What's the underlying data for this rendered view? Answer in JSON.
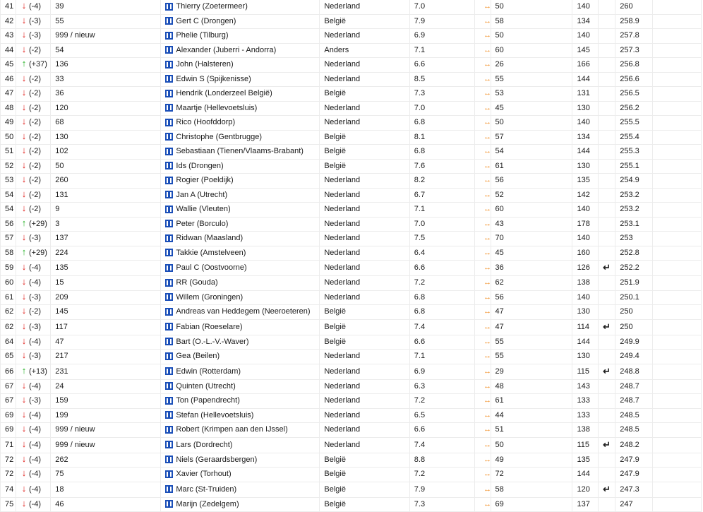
{
  "colors": {
    "down": "#e0201c",
    "up": "#22b022",
    "swap": "#f08a1c",
    "player_icon": "#1b4fb8"
  },
  "icons": {
    "down": "arrow-down-icon",
    "up": "arrow-up-icon",
    "player": "player-icon",
    "swap": "swap-arrows-icon",
    "return": "return-arrow-icon"
  },
  "rows": [
    {
      "rank": "41",
      "dir": "down",
      "change": "(-4)",
      "num": "39",
      "name": "Thierry (Zoetermeer)",
      "land": "Nederland",
      "score": "7.0",
      "a": "50",
      "b": "140",
      "ret": false,
      "total": "260"
    },
    {
      "rank": "42",
      "dir": "down",
      "change": "(-3)",
      "num": "55",
      "name": "Gert C (Drongen)",
      "land": "België",
      "score": "7.9",
      "a": "58",
      "b": "134",
      "ret": false,
      "total": "258.9"
    },
    {
      "rank": "43",
      "dir": "down",
      "change": "(-3)",
      "num": "999 / nieuw",
      "name": "Phelie (Tilburg)",
      "land": "Nederland",
      "score": "6.9",
      "a": "50",
      "b": "140",
      "ret": false,
      "total": "257.8"
    },
    {
      "rank": "44",
      "dir": "down",
      "change": "(-2)",
      "num": "54",
      "name": "Alexander (Juberri - Andorra)",
      "land": "Anders",
      "score": "7.1",
      "a": "60",
      "b": "145",
      "ret": false,
      "total": "257.3"
    },
    {
      "rank": "45",
      "dir": "up",
      "change": "(+37)",
      "num": "136",
      "name": "John (Halsteren)",
      "land": "Nederland",
      "score": "6.6",
      "a": "26",
      "b": "166",
      "ret": false,
      "total": "256.8"
    },
    {
      "rank": "46",
      "dir": "down",
      "change": "(-2)",
      "num": "33",
      "name": "Edwin S (Spijkenisse)",
      "land": "Nederland",
      "score": "8.5",
      "a": "55",
      "b": "144",
      "ret": false,
      "total": "256.6"
    },
    {
      "rank": "47",
      "dir": "down",
      "change": "(-2)",
      "num": "36",
      "name": "Hendrik (Londerzeel België)",
      "land": "België",
      "score": "7.3",
      "a": "53",
      "b": "131",
      "ret": false,
      "total": "256.5"
    },
    {
      "rank": "48",
      "dir": "down",
      "change": "(-2)",
      "num": "120",
      "name": "Maartje (Hellevoetsluis)",
      "land": "Nederland",
      "score": "7.0",
      "a": "45",
      "b": "130",
      "ret": false,
      "total": "256.2"
    },
    {
      "rank": "49",
      "dir": "down",
      "change": "(-2)",
      "num": "68",
      "name": "Rico (Hoofddorp)",
      "land": "Nederland",
      "score": "6.8",
      "a": "50",
      "b": "140",
      "ret": false,
      "total": "255.5"
    },
    {
      "rank": "50",
      "dir": "down",
      "change": "(-2)",
      "num": "130",
      "name": "Christophe (Gentbrugge)",
      "land": "België",
      "score": "8.1",
      "a": "57",
      "b": "134",
      "ret": false,
      "total": "255.4"
    },
    {
      "rank": "51",
      "dir": "down",
      "change": "(-2)",
      "num": "102",
      "name": "Sebastiaan (Tienen/Vlaams-Brabant)",
      "land": "België",
      "score": "6.8",
      "a": "54",
      "b": "144",
      "ret": false,
      "total": "255.3"
    },
    {
      "rank": "52",
      "dir": "down",
      "change": "(-2)",
      "num": "50",
      "name": "Ids (Drongen)",
      "land": "België",
      "score": "7.6",
      "a": "61",
      "b": "130",
      "ret": false,
      "total": "255.1"
    },
    {
      "rank": "53",
      "dir": "down",
      "change": "(-2)",
      "num": "260",
      "name": "Rogier (Poeldijk)",
      "land": "Nederland",
      "score": "8.2",
      "a": "56",
      "b": "135",
      "ret": false,
      "total": "254.9"
    },
    {
      "rank": "54",
      "dir": "down",
      "change": "(-2)",
      "num": "131",
      "name": "Jan A (Utrecht)",
      "land": "Nederland",
      "score": "6.7",
      "a": "52",
      "b": "142",
      "ret": false,
      "total": "253.2"
    },
    {
      "rank": "54",
      "dir": "down",
      "change": "(-2)",
      "num": "9",
      "name": "Wallie (Vleuten)",
      "land": "Nederland",
      "score": "7.1",
      "a": "60",
      "b": "140",
      "ret": false,
      "total": "253.2"
    },
    {
      "rank": "56",
      "dir": "up",
      "change": "(+29)",
      "num": "3",
      "name": "Peter (Borculo)",
      "land": "Nederland",
      "score": "7.0",
      "a": "43",
      "b": "178",
      "ret": false,
      "total": "253.1"
    },
    {
      "rank": "57",
      "dir": "down",
      "change": "(-3)",
      "num": "137",
      "name": "Ridwan (Maasland)",
      "land": "Nederland",
      "score": "7.5",
      "a": "70",
      "b": "140",
      "ret": false,
      "total": "253"
    },
    {
      "rank": "58",
      "dir": "up",
      "change": "(+29)",
      "num": "224",
      "name": "Takkie (Amstelveen)",
      "land": "Nederland",
      "score": "6.4",
      "a": "45",
      "b": "160",
      "ret": false,
      "total": "252.8"
    },
    {
      "rank": "59",
      "dir": "down",
      "change": "(-4)",
      "num": "135",
      "name": "Paul C (Oostvoorne)",
      "land": "Nederland",
      "score": "6.6",
      "a": "36",
      "b": "126",
      "ret": true,
      "total": "252.2"
    },
    {
      "rank": "60",
      "dir": "down",
      "change": "(-4)",
      "num": "15",
      "name": "RR (Gouda)",
      "land": "Nederland",
      "score": "7.2",
      "a": "62",
      "b": "138",
      "ret": false,
      "total": "251.9"
    },
    {
      "rank": "61",
      "dir": "down",
      "change": "(-3)",
      "num": "209",
      "name": "Willem (Groningen)",
      "land": "Nederland",
      "score": "6.8",
      "a": "56",
      "b": "140",
      "ret": false,
      "total": "250.1"
    },
    {
      "rank": "62",
      "dir": "down",
      "change": "(-2)",
      "num": "145",
      "name": "Andreas van Heddegem (Neeroeteren)",
      "land": "België",
      "score": "6.8",
      "a": "47",
      "b": "130",
      "ret": false,
      "total": "250"
    },
    {
      "rank": "62",
      "dir": "down",
      "change": "(-3)",
      "num": "117",
      "name": "Fabian (Roeselare)",
      "land": "België",
      "score": "7.4",
      "a": "47",
      "b": "114",
      "ret": true,
      "total": "250"
    },
    {
      "rank": "64",
      "dir": "down",
      "change": "(-4)",
      "num": "47",
      "name": "Bart (O.-L.-V.-Waver)",
      "land": "België",
      "score": "6.6",
      "a": "55",
      "b": "144",
      "ret": false,
      "total": "249.9"
    },
    {
      "rank": "65",
      "dir": "down",
      "change": "(-3)",
      "num": "217",
      "name": "Gea (Beilen)",
      "land": "Nederland",
      "score": "7.1",
      "a": "55",
      "b": "130",
      "ret": false,
      "total": "249.4"
    },
    {
      "rank": "66",
      "dir": "up",
      "change": "(+13)",
      "num": "231",
      "name": "Edwin (Rotterdam)",
      "land": "Nederland",
      "score": "6.9",
      "a": "29",
      "b": "115",
      "ret": true,
      "total": "248.8"
    },
    {
      "rank": "67",
      "dir": "down",
      "change": "(-4)",
      "num": "24",
      "name": "Quinten (Utrecht)",
      "land": "Nederland",
      "score": "6.3",
      "a": "48",
      "b": "143",
      "ret": false,
      "total": "248.7"
    },
    {
      "rank": "67",
      "dir": "down",
      "change": "(-3)",
      "num": "159",
      "name": "Ton (Papendrecht)",
      "land": "Nederland",
      "score": "7.2",
      "a": "61",
      "b": "133",
      "ret": false,
      "total": "248.7"
    },
    {
      "rank": "69",
      "dir": "down",
      "change": "(-4)",
      "num": "199",
      "name": "Stefan (Hellevoetsluis)",
      "land": "Nederland",
      "score": "6.5",
      "a": "44",
      "b": "133",
      "ret": false,
      "total": "248.5"
    },
    {
      "rank": "69",
      "dir": "down",
      "change": "(-4)",
      "num": "999 / nieuw",
      "name": "Robert (Krimpen aan den IJssel)",
      "land": "Nederland",
      "score": "6.6",
      "a": "51",
      "b": "138",
      "ret": false,
      "total": "248.5"
    },
    {
      "rank": "71",
      "dir": "down",
      "change": "(-4)",
      "num": "999 / nieuw",
      "name": "Lars (Dordrecht)",
      "land": "Nederland",
      "score": "7.4",
      "a": "50",
      "b": "115",
      "ret": true,
      "total": "248.2"
    },
    {
      "rank": "72",
      "dir": "down",
      "change": "(-4)",
      "num": "262",
      "name": "Niels (Geraardsbergen)",
      "land": "België",
      "score": "8.8",
      "a": "49",
      "b": "135",
      "ret": false,
      "total": "247.9"
    },
    {
      "rank": "72",
      "dir": "down",
      "change": "(-4)",
      "num": "75",
      "name": "Xavier (Torhout)",
      "land": "België",
      "score": "7.2",
      "a": "72",
      "b": "144",
      "ret": false,
      "total": "247.9"
    },
    {
      "rank": "74",
      "dir": "down",
      "change": "(-4)",
      "num": "18",
      "name": "Marc (St-Truiden)",
      "land": "België",
      "score": "7.9",
      "a": "58",
      "b": "120",
      "ret": true,
      "total": "247.3"
    },
    {
      "rank": "75",
      "dir": "down",
      "change": "(-4)",
      "num": "46",
      "name": "Marijn (Zedelgem)",
      "land": "België",
      "score": "7.3",
      "a": "69",
      "b": "137",
      "ret": false,
      "total": "247"
    }
  ]
}
